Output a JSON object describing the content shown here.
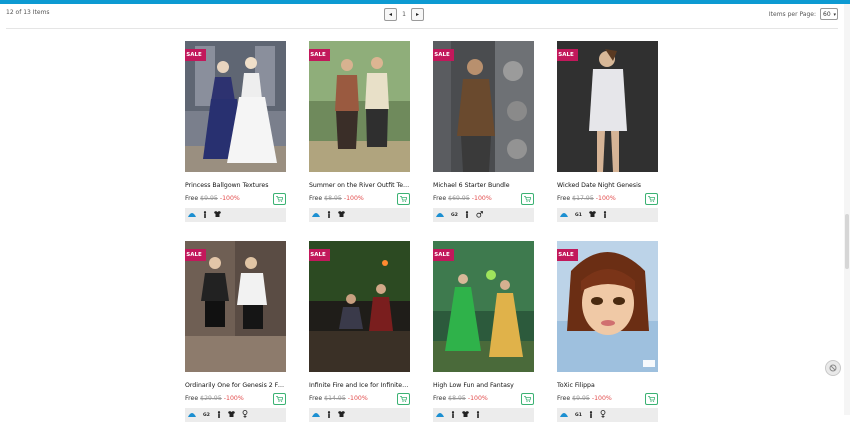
{
  "colors": {
    "accent": "#0d9ad2",
    "sale": "#c2185b",
    "cart": "#3bb273",
    "discount": "#e24b4b"
  },
  "toolbar": {
    "result_count": "12 of 13 Items",
    "pager": {
      "prev": "◂",
      "page": "1",
      "next": "▸"
    },
    "items_per_page_label": "Items per Page:",
    "items_per_page_value": "60"
  },
  "products": [
    {
      "title": "Princess Ballgown Textures",
      "sale": "SALE",
      "free": "Free",
      "original_price": "$9.95",
      "discount": "-100%",
      "icons": [
        "genesis-logo-icon",
        "figure-icon",
        "clothing-icon"
      ]
    },
    {
      "title": "Summer on the River Outfit Tex...",
      "sale": "SALE",
      "free": "Free",
      "original_price": "$8.95",
      "discount": "-100%",
      "icons": [
        "genesis-logo-icon",
        "figure-icon",
        "clothing-icon"
      ]
    },
    {
      "title": "Michael 6 Starter Bundle",
      "sale": "SALE",
      "free": "Free",
      "original_price": "$69.95",
      "discount": "-100%",
      "icons": [
        "genesis-logo-icon",
        "g2-badge-icon",
        "figure-icon",
        "male-icon"
      ]
    },
    {
      "title": "Wicked Date Night Genesis",
      "sale": "SALE",
      "free": "Free",
      "original_price": "$17.95",
      "discount": "-100%",
      "icons": [
        "genesis-logo-icon",
        "g1-badge-icon",
        "clothing-icon",
        "figure-icon"
      ]
    },
    {
      "title": "Ordinarily One for Genesis 2 Fe...",
      "sale": "SALE",
      "free": "Free",
      "original_price": "$29.95",
      "discount": "-100%",
      "icons": [
        "genesis-logo-icon",
        "g2-badge-icon",
        "figure-icon",
        "clothing-icon",
        "female-icon"
      ]
    },
    {
      "title": "Infinite Fire and Ice for Infinite D...",
      "sale": "SALE",
      "free": "Free",
      "original_price": "$14.95",
      "discount": "-100%",
      "icons": [
        "genesis-logo-icon",
        "figure-icon",
        "clothing-icon"
      ]
    },
    {
      "title": "High Low Fun and Fantasy",
      "sale": "SALE",
      "free": "Free",
      "original_price": "$8.95",
      "discount": "-100%",
      "icons": [
        "genesis-logo-icon",
        "figure-icon",
        "clothing-icon",
        "figure-icon"
      ]
    },
    {
      "title": "ToXic Filippa",
      "sale": "SALE",
      "free": "Free",
      "original_price": "$9.95",
      "discount": "-100%",
      "icons": [
        "genesis-logo-icon",
        "g1-badge-icon",
        "figure-icon",
        "female-icon"
      ]
    }
  ]
}
